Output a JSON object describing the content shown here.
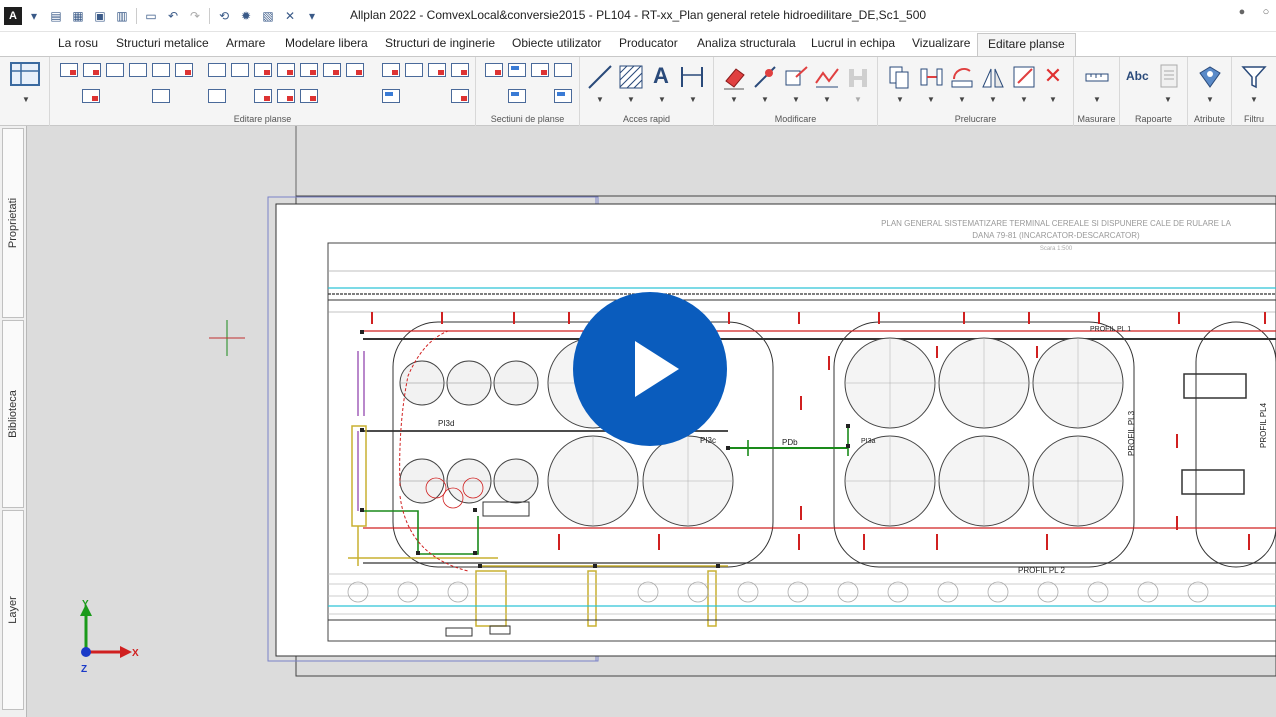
{
  "window": {
    "title": "Allplan 2022 - ComvexLocal&conversie2015 - PL104 - RT-xx_Plan general retele hidroedilitare_DE,Sc1_500",
    "logo": "A",
    "help_icon": "person-icon",
    "search_icon": "search-icon"
  },
  "quick_access": [
    "new-document-icon",
    "open-icon",
    "save-icon",
    "print-icon",
    "undo-icon",
    "redo-icon",
    "pan-icon",
    "settings-icon",
    "layout-icon",
    "tools-icon",
    "customize-icon"
  ],
  "tabs": [
    "La rosu",
    "Structuri metalice",
    "Armare",
    "Modelare libera",
    "Structuri de inginerie",
    "Obiecte utilizator",
    "Producator",
    "Analiza structurala",
    "Lucrul in echipa",
    "Vizualizare",
    "Editare planse"
  ],
  "active_tab": "Editare planse",
  "ribbon_groups": [
    "Editare planse",
    "Sectiuni de planse",
    "Acces rapid",
    "Modificare",
    "Prelucrare",
    "Masurare",
    "Rapoarte",
    "Atribute",
    "Filtru"
  ],
  "side_tabs": [
    "Proprietati",
    "Biblioteca",
    "Layer"
  ],
  "axes": {
    "y": "Y",
    "x": "X",
    "z": "Z"
  },
  "drawing": {
    "heading_line1": "PLAN GENERAL SISTEMATIZARE TERMINAL CEREALE SI DISPUNERE CALE DE RULARE LA",
    "heading_line2": "DANA 79-81 (INCARCATOR-DESCARCATOR)",
    "scale": "Scara 1:500",
    "labels": {
      "profil_pl1": "PROFIL PL 1",
      "profil_pl2": "PROFIL PL 2",
      "profil_pl3": "PROFIL PL3",
      "profil_pl4": "PROFIL PL4",
      "pl3d": "PI3d",
      "pl3c": "PI3c",
      "pdb": "PDb",
      "pl3a": "PI3a"
    }
  },
  "colors": {
    "accent_blue": "#0a5cbd",
    "cad_red": "#d02020",
    "cad_green": "#1a8a1a",
    "cad_cyan": "#2ec4d6",
    "cad_yellow": "#c8b030",
    "cad_purple": "#8a3aa8"
  }
}
